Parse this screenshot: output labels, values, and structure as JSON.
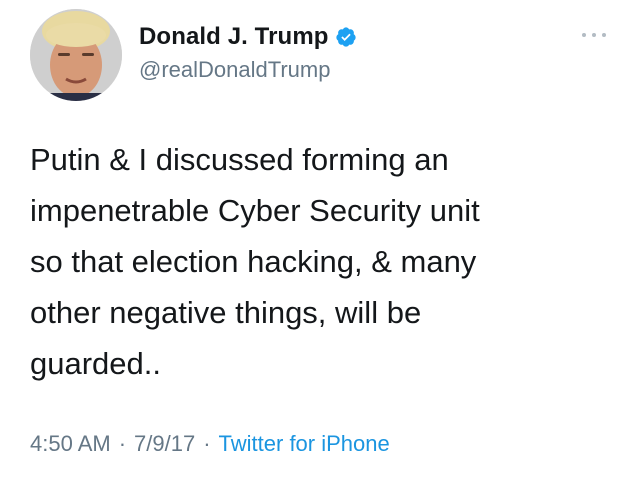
{
  "author": {
    "name": "Donald J. Trump",
    "handle": "@realDonaldTrump",
    "verified": true,
    "avatar_icon": "profile-photo"
  },
  "more_icon": "ellipsis-icon",
  "tweet": {
    "text": "Putin & I discussed forming an\nimpenetrable Cyber Security unit\nso that election hacking, & many\nother negative things, will be\nguarded.."
  },
  "meta": {
    "time": "4:50 AM",
    "separator": "·",
    "date": "7/9/17",
    "source": "Twitter for iPhone"
  },
  "colors": {
    "text": "#14171a",
    "secondary": "#657786",
    "link": "#1b95e0",
    "verified": "#1da1f2"
  }
}
